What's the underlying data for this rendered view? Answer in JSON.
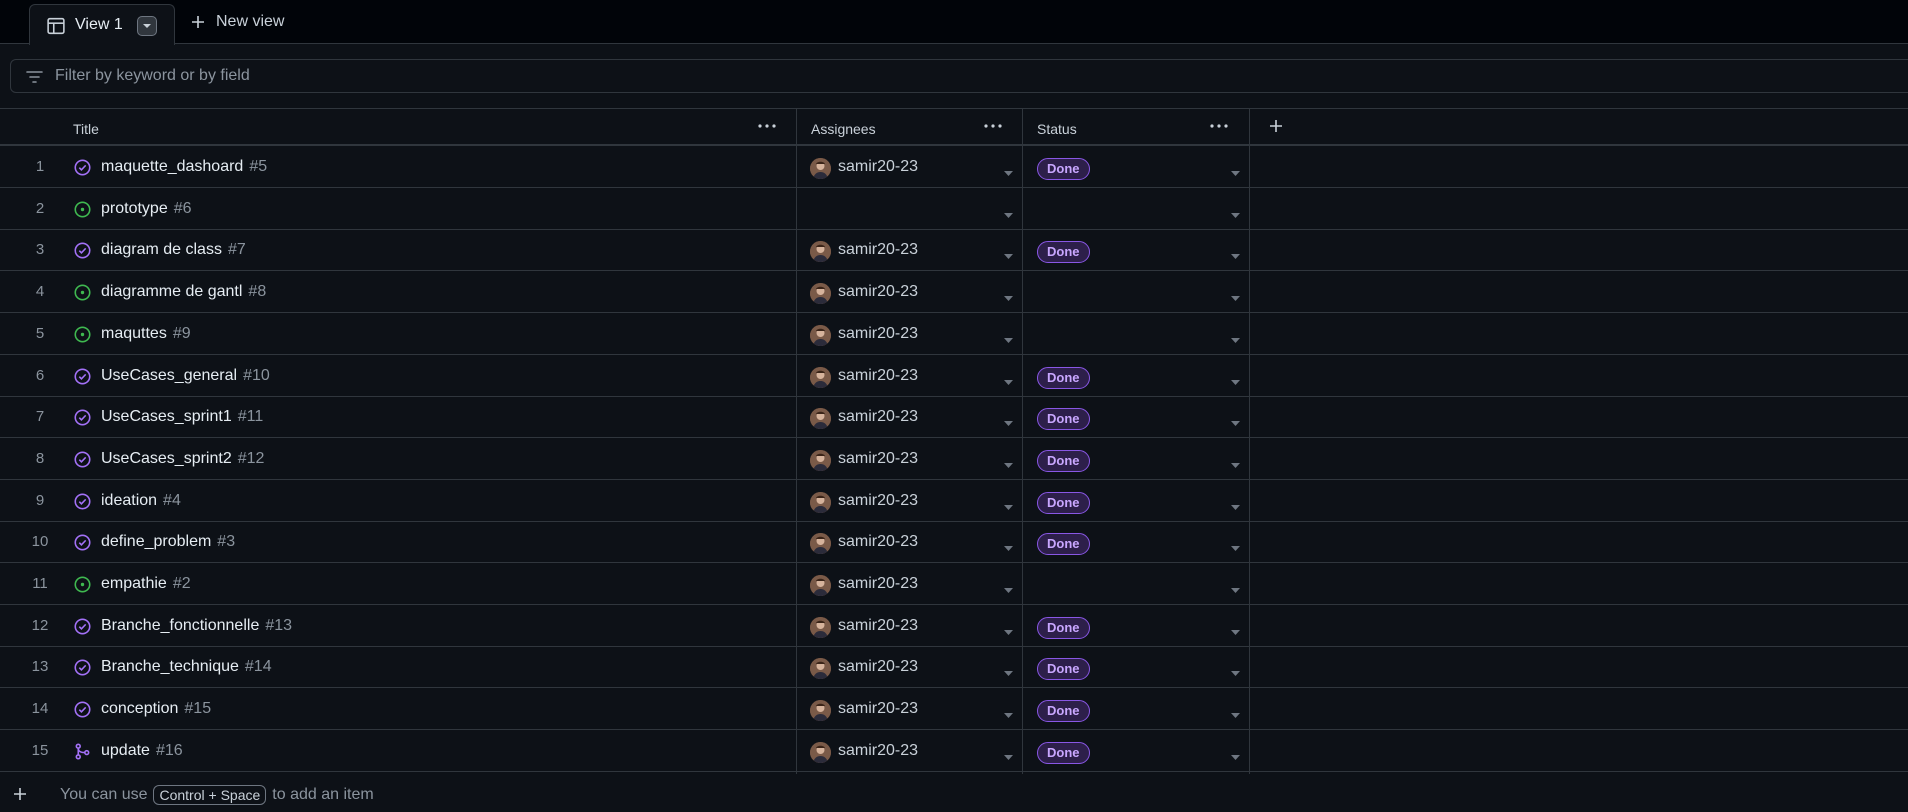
{
  "tabs": {
    "active_label": "View 1",
    "new_view_label": "New view"
  },
  "filter": {
    "placeholder": "Filter by keyword or by field"
  },
  "columns": {
    "title": "Title",
    "assignees": "Assignees",
    "status": "Status"
  },
  "rows": [
    {
      "num": "1",
      "title": "maquette_dashoard",
      "issue": "#5",
      "assignee": "samir20-23",
      "status": "Done",
      "state": "closed"
    },
    {
      "num": "2",
      "title": "prototype",
      "issue": "#6",
      "assignee": "",
      "status": "",
      "state": "open"
    },
    {
      "num": "3",
      "title": "diagram de class",
      "issue": "#7",
      "assignee": "samir20-23",
      "status": "Done",
      "state": "closed"
    },
    {
      "num": "4",
      "title": "diagramme de gantl",
      "issue": "#8",
      "assignee": "samir20-23",
      "status": "",
      "state": "open"
    },
    {
      "num": "5",
      "title": "maquttes",
      "issue": "#9",
      "assignee": "samir20-23",
      "status": "",
      "state": "open"
    },
    {
      "num": "6",
      "title": "UseCases_general",
      "issue": "#10",
      "assignee": "samir20-23",
      "status": "Done",
      "state": "closed"
    },
    {
      "num": "7",
      "title": "UseCases_sprint1",
      "issue": "#11",
      "assignee": "samir20-23",
      "status": "Done",
      "state": "closed"
    },
    {
      "num": "8",
      "title": "UseCases_sprint2",
      "issue": "#12",
      "assignee": "samir20-23",
      "status": "Done",
      "state": "closed"
    },
    {
      "num": "9",
      "title": "ideation",
      "issue": "#4",
      "assignee": "samir20-23",
      "status": "Done",
      "state": "closed"
    },
    {
      "num": "10",
      "title": "define_problem",
      "issue": "#3",
      "assignee": "samir20-23",
      "status": "Done",
      "state": "closed"
    },
    {
      "num": "11",
      "title": "empathie",
      "issue": "#2",
      "assignee": "samir20-23",
      "status": "",
      "state": "open"
    },
    {
      "num": "12",
      "title": "Branche_fonctionnelle",
      "issue": "#13",
      "assignee": "samir20-23",
      "status": "Done",
      "state": "closed"
    },
    {
      "num": "13",
      "title": "Branche_technique",
      "issue": "#14",
      "assignee": "samir20-23",
      "status": "Done",
      "state": "closed"
    },
    {
      "num": "14",
      "title": "conception",
      "issue": "#15",
      "assignee": "samir20-23",
      "status": "Done",
      "state": "closed"
    },
    {
      "num": "15",
      "title": "update",
      "issue": "#16",
      "assignee": "samir20-23",
      "status": "Done",
      "state": "merged"
    }
  ],
  "footer": {
    "prefix": "You can use",
    "shortcut": "Control + Space",
    "suffix": "to add an item"
  },
  "colors": {
    "closed_icon": "#a371f7",
    "open_icon": "#3fb950",
    "merged_icon": "#a371f7",
    "done_badge": "#8957e5"
  }
}
